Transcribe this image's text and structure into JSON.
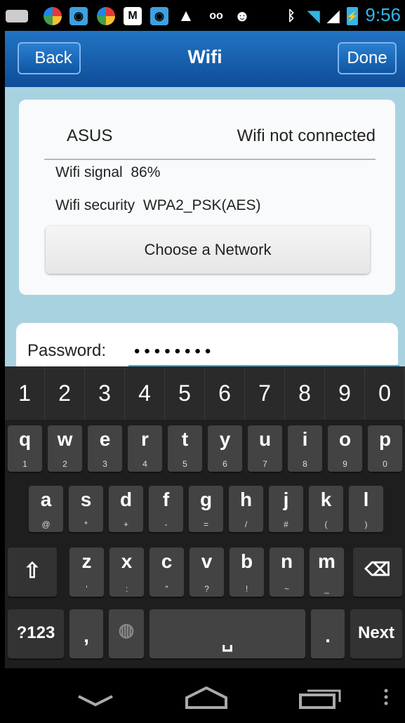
{
  "status_bar": {
    "time": "9:56",
    "icons": [
      "keyboard-icon",
      "app-icon",
      "camera-icon",
      "app-icon",
      "gmail-icon",
      "camera-icon",
      "warning-icon",
      "voicemail-icon",
      "android-icon",
      "bluetooth-icon",
      "wifi-icon",
      "signal-icon",
      "battery-icon"
    ]
  },
  "header": {
    "back_label": "Back",
    "title": "Wifi",
    "done_label": "Done"
  },
  "wifi_card": {
    "network_name": "ASUS",
    "connection_status": "Wifi not connected",
    "signal_label": "Wifi signal",
    "signal_value": "86%",
    "security_label": "Wifi security",
    "security_value": "WPA2_PSK(AES)",
    "choose_button": "Choose a Network"
  },
  "password": {
    "label": "Password:",
    "value": "••••••••"
  },
  "keyboard": {
    "numbers": [
      "1",
      "2",
      "3",
      "4",
      "5",
      "6",
      "7",
      "8",
      "9",
      "0"
    ],
    "row1": [
      {
        "key": "q",
        "sub": "1"
      },
      {
        "key": "w",
        "sub": "2"
      },
      {
        "key": "e",
        "sub": "3"
      },
      {
        "key": "r",
        "sub": "4"
      },
      {
        "key": "t",
        "sub": "5"
      },
      {
        "key": "y",
        "sub": "6"
      },
      {
        "key": "u",
        "sub": "7"
      },
      {
        "key": "i",
        "sub": "8"
      },
      {
        "key": "o",
        "sub": "9"
      },
      {
        "key": "p",
        "sub": "0"
      }
    ],
    "row2": [
      {
        "key": "a",
        "sub": "@"
      },
      {
        "key": "s",
        "sub": "*"
      },
      {
        "key": "d",
        "sub": "+"
      },
      {
        "key": "f",
        "sub": "-"
      },
      {
        "key": "g",
        "sub": "="
      },
      {
        "key": "h",
        "sub": "/"
      },
      {
        "key": "j",
        "sub": "#"
      },
      {
        "key": "k",
        "sub": "("
      },
      {
        "key": "l",
        "sub": ")"
      }
    ],
    "row3": [
      {
        "key": "z",
        "sub": "'"
      },
      {
        "key": "x",
        "sub": ":"
      },
      {
        "key": "c",
        "sub": "\""
      },
      {
        "key": "v",
        "sub": "?"
      },
      {
        "key": "b",
        "sub": "!"
      },
      {
        "key": "n",
        "sub": "~"
      },
      {
        "key": "m",
        "sub": "_"
      }
    ],
    "symbols_label": "?123",
    "comma": ",",
    "period": ".",
    "next_label": "Next"
  }
}
